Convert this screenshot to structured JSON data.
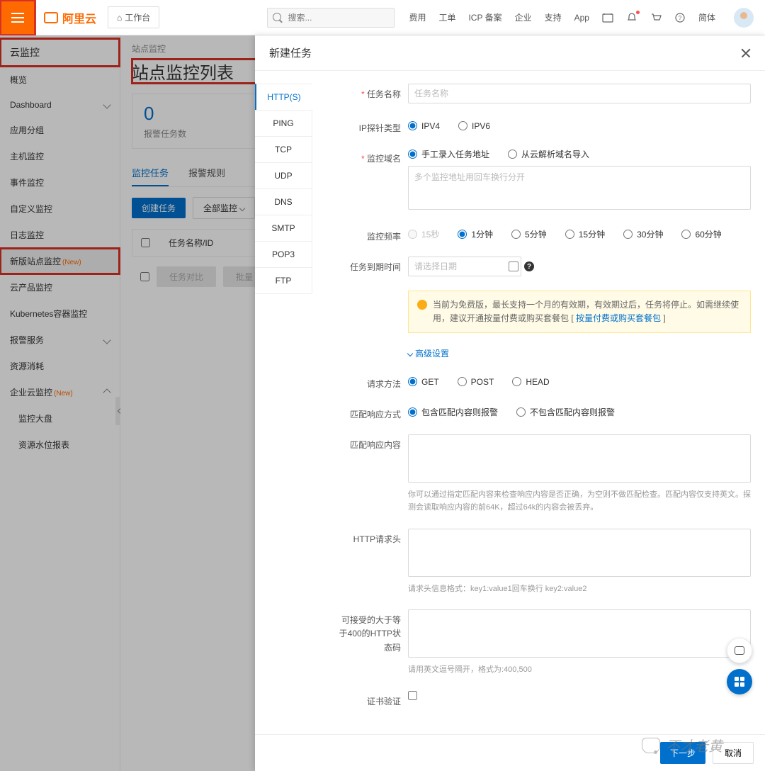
{
  "header": {
    "logo": "阿里云",
    "workbench": "工作台",
    "search_placeholder": "搜索...",
    "links": [
      "费用",
      "工单",
      "ICP 备案",
      "企业",
      "支持",
      "App"
    ],
    "lang": "简体"
  },
  "sidebar": {
    "title": "云监控",
    "items": [
      {
        "label": "概览"
      },
      {
        "label": "Dashboard",
        "expand": true
      },
      {
        "label": "应用分组"
      },
      {
        "label": "主机监控"
      },
      {
        "label": "事件监控"
      },
      {
        "label": "自定义监控"
      },
      {
        "label": "日志监控"
      },
      {
        "label": "新版站点监控",
        "new": true,
        "active": true
      },
      {
        "label": "云产品监控"
      },
      {
        "label": "Kubernetes容器监控"
      },
      {
        "label": "报警服务",
        "expand": true
      },
      {
        "label": "资源消耗"
      },
      {
        "label": "企业云监控",
        "new": true,
        "expand": true,
        "open": true
      },
      {
        "label": "监控大盘",
        "indent": true
      },
      {
        "label": "资源水位报表",
        "indent": true
      }
    ]
  },
  "main": {
    "breadcrumb": "站点监控",
    "title": "站点监控列表",
    "card_num": "0",
    "card_label": "报警任务数",
    "tabs": [
      "监控任务",
      "报警规则"
    ],
    "create_btn": "创建任务",
    "filter": "全部监控",
    "th1": "任务名称/ID",
    "ghost1": "任务对比",
    "ghost2": "批量"
  },
  "drawer": {
    "title": "新建任务",
    "proto_tabs": [
      "HTTP(S)",
      "PING",
      "TCP",
      "UDP",
      "DNS",
      "SMTP",
      "POP3",
      "FTP"
    ],
    "labels": {
      "task_name": "任务名称",
      "probe_type": "IP探针类型",
      "domain": "监控域名",
      "freq": "监控频率",
      "expire": "任务到期时间",
      "adv": "高级设置",
      "method": "请求方法",
      "match_mode": "匹配响应方式",
      "match_content": "匹配响应内容",
      "headers": "HTTP请求头",
      "status_ge": "可接受的大于等于400的HTTP状态码",
      "cert": "证书验证"
    },
    "placeholders": {
      "task_name": "任务名称",
      "domain": "多个监控地址用回车换行分开",
      "expire": "请选择日期"
    },
    "radios": {
      "probe": [
        "IPV4",
        "IPV6"
      ],
      "domain_mode": [
        "手工录入任务地址",
        "从云解析域名导入"
      ],
      "freq": [
        "15秒",
        "1分钟",
        "5分钟",
        "15分钟",
        "30分钟",
        "60分钟"
      ],
      "method": [
        "GET",
        "POST",
        "HEAD"
      ],
      "match": [
        "包含匹配内容则报警",
        "不包含匹配内容则报警"
      ]
    },
    "alert_text": "当前为免费版，最长支持一个月的有效期，有效期过后，任务将停止。如需继续使用，建议开通按量付费或购买套餐包 [ ",
    "alert_link": "按量付费或购买套餐包",
    "alert_suffix": " ]",
    "hints": {
      "match": "你可以通过指定匹配内容来检查响应内容是否正确，为空则不做匹配检查。匹配内容仅支持英文。探测会读取响应内容的前64K，超过64k的内容会被丢弃。",
      "headers": "请求头信息格式：key1:value1回车换行 key2:value2",
      "status": "请用英文逗号隔开，格式为:400,500"
    },
    "footer": {
      "next": "下一步",
      "cancel": "取消"
    }
  },
  "watermark": "不才老黄"
}
